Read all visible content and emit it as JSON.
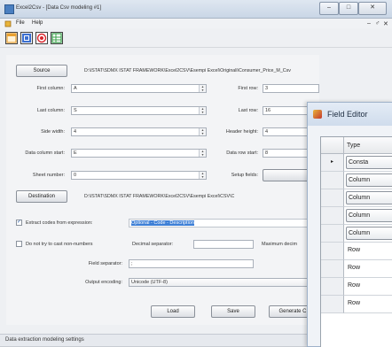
{
  "window": {
    "title": "Excel2Csv - [Data Csv modeling #1]",
    "minimize": "–",
    "maximize": "□",
    "close": "✕"
  },
  "menu": {
    "items": [
      "File",
      "Help"
    ],
    "mdi_controls": [
      "–",
      "♂",
      "✕"
    ]
  },
  "toolbar": {
    "buttons": [
      {
        "icon": "window-icon",
        "color": "#e8a030"
      },
      {
        "icon": "data-grid-icon",
        "color": "#3b6fd0"
      },
      {
        "icon": "target-icon",
        "color": "#d8242b"
      },
      {
        "icon": "table-icon",
        "color": "#3aa24a"
      }
    ]
  },
  "source": {
    "button_label": "Source",
    "path": "D:\\ISTAT\\SDMX ISTAT FRAMEWORK\\Excel2CSV\\Esempi Excel\\Originali\\Consumer_Price_M_Csv",
    "first_column_label": "First column:",
    "first_column_value": "A",
    "first_row_label": "First row:",
    "first_row_value": "3",
    "last_column_label": "Last column:",
    "last_column_value": "S",
    "last_row_label": "Last row:",
    "last_row_value": "16",
    "side_width_label": "Side width:",
    "side_width_value": "4",
    "header_height_label": "Header height:",
    "header_height_value": "4",
    "data_column_start_label": "Data column start:",
    "data_column_start_value": "E",
    "data_row_start_label": "Data row start:",
    "data_row_start_value": "8",
    "sheet_number_label": "Sheet number:",
    "sheet_number_value": "0",
    "setup_fields_label": "Setup fields:"
  },
  "destination": {
    "button_label": "Destination",
    "path": "D:\\ISTAT\\SDMX ISTAT FRAMEWORK\\Excel2CSV\\Esempi Excel\\CSV\\C"
  },
  "options": {
    "extract_codes_label": "Extract codes from expression:",
    "extract_codes_checked": true,
    "extract_codes_value": "Optional - Code - Description",
    "no_cast_label": "Do not try to cast non-numbers",
    "no_cast_checked": false,
    "decimal_separator_label": "Decimal separator:",
    "decimal_separator_value": "",
    "maximum_decimals_label": "Maximum decim",
    "field_separator_label": "Field separator:",
    "field_separator_value": ";",
    "output_encoding_label": "Output encoding:",
    "output_encoding_value": "Unicode (UTF-8)"
  },
  "actions": {
    "load": "Load",
    "save": "Save",
    "generate": "Generate C"
  },
  "status": {
    "text": "Data extraction modeling settings"
  },
  "field_editor": {
    "title": "Field Editor",
    "columns": [
      "",
      "Type"
    ],
    "rows": [
      {
        "marker": "▸",
        "type": "Consta",
        "boxed": true
      },
      {
        "marker": "",
        "type": "Column",
        "boxed": true
      },
      {
        "marker": "",
        "type": "Column",
        "boxed": true
      },
      {
        "marker": "",
        "type": "Column",
        "boxed": true
      },
      {
        "marker": "",
        "type": "Column",
        "boxed": true
      },
      {
        "marker": "",
        "type": "Row",
        "boxed": false
      },
      {
        "marker": "",
        "type": "Row",
        "boxed": false
      },
      {
        "marker": "",
        "type": "Row",
        "boxed": false
      },
      {
        "marker": "",
        "type": "Row",
        "boxed": false
      }
    ]
  }
}
